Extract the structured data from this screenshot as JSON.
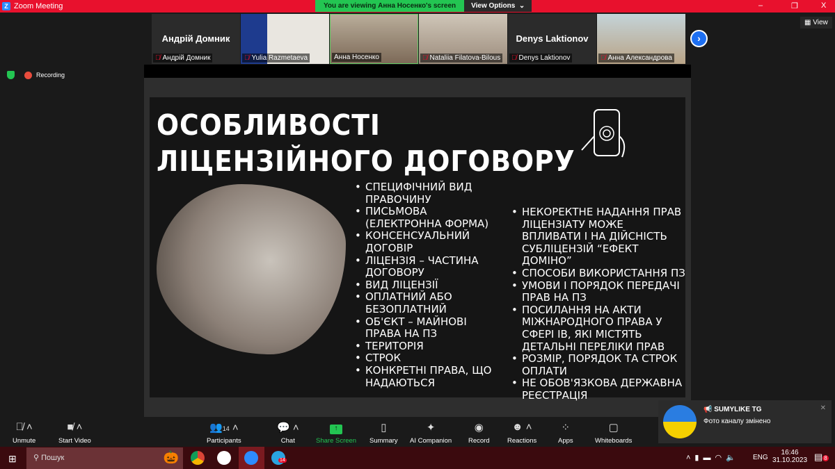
{
  "window": {
    "title": "Zoom Meeting",
    "minimize": "–",
    "maximize": "❐",
    "close": "X"
  },
  "banner": {
    "viewing": "You are viewing Анна Носенко's screen",
    "view_options": "View Options"
  },
  "view_button": "View",
  "participants_strip": [
    {
      "big_name": "Андрій Домник",
      "label": "Андрій Домник",
      "muted": true,
      "video": false
    },
    {
      "big_name": "",
      "label": "Yulia Razmetaeva",
      "muted": true,
      "video": true
    },
    {
      "big_name": "",
      "label": "Анна Носенко",
      "muted": false,
      "video": true
    },
    {
      "big_name": "",
      "label": "Nataliia Filatova-Bilous",
      "muted": true,
      "video": true
    },
    {
      "big_name": "Denys Laktionov",
      "label": "Denys Laktionov",
      "muted": true,
      "video": false
    },
    {
      "big_name": "",
      "label": "Анна Александрова",
      "muted": true,
      "video": true
    }
  ],
  "recording": "Recording",
  "slide": {
    "title_line1": "ОСОБЛИВОСТІ",
    "title_line2": "ЛІЦЕНЗІЙНОГО ДОГОВОРУ",
    "left_bullets": [
      "Специфічний вид правочину",
      "Письмова (електронна форма)",
      "Консенсуальний договір",
      "Ліцензія – частина договору",
      "Вид ліцензії",
      "Оплатний або безоплатний",
      "Об'єкт – майнові права на ПЗ",
      "Територія",
      "Строк",
      "Конкретні права, що надаються"
    ],
    "right_bullets": [
      "Некоректне надання прав ліцензіату може впливати і на дійсність субліцензій “ефект доміно”",
      "Способи використання ПЗ",
      "Умови і порядок передачі прав на ПЗ",
      "Посилання на акти міжнародного права у сфері ІВ, які містять детальні переліки прав",
      "Розмір, порядок та строк оплати",
      "Не обов'язкова державна реєстрація"
    ]
  },
  "toolbar": {
    "unmute": "Unmute",
    "start_video": "Start Video",
    "participants": "Participants",
    "participants_count": "14",
    "chat": "Chat",
    "share_screen": "Share Screen",
    "summary": "Summary",
    "ai_companion": "AI Companion",
    "record": "Record",
    "reactions": "Reactions",
    "apps": "Apps",
    "whiteboards": "Whiteboards"
  },
  "notification": {
    "title": "SUMYLIKE TG",
    "body": "Фото каналу змінено"
  },
  "taskbar": {
    "search_placeholder": "Пошук",
    "language": "ENG",
    "time": "16:46",
    "date": "31.10.2023",
    "notifications_count": "8",
    "telegram_badge": "14"
  },
  "colors": {
    "titlebar": "#e8112d",
    "banner_green": "#23c552",
    "taskbar": "#3b0a0e",
    "share_green": "#23c552"
  }
}
